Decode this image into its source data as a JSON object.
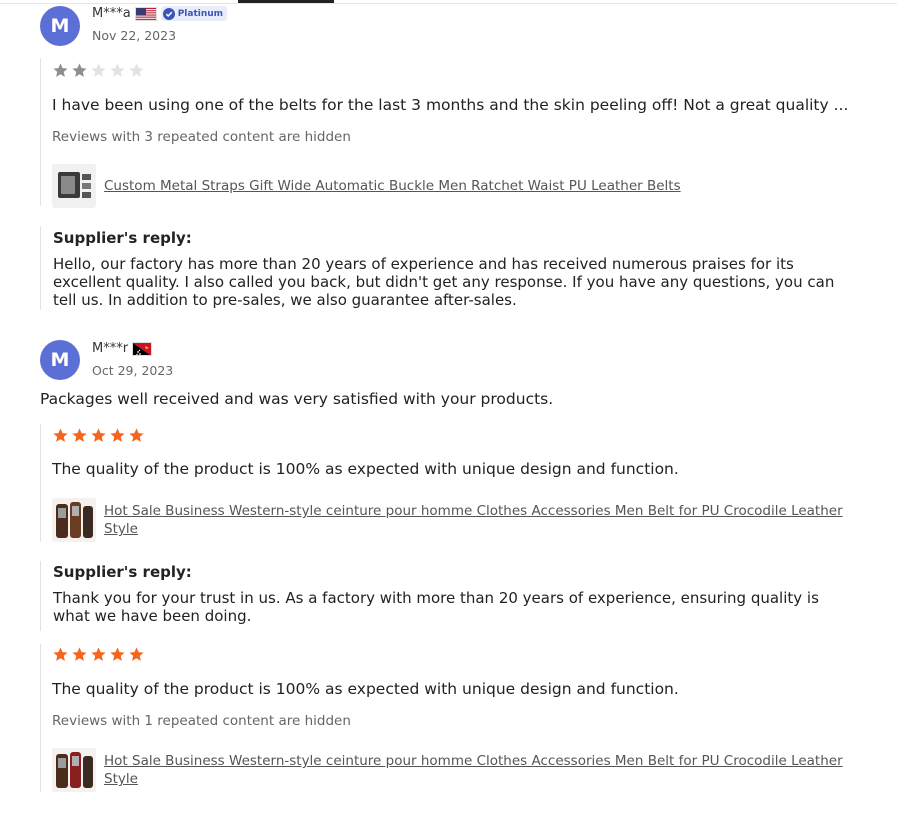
{
  "colors": {
    "avatar": "#5b6fd6",
    "star_filled_orange": "#f5651d",
    "star_filled_gray": "#8e8e8e",
    "star_empty": "#e3e3e3",
    "badge_bg": "#e8edf9",
    "badge_text": "#3b56b8"
  },
  "reviews": [
    {
      "avatar_letter": "M",
      "user": "M***a",
      "flag": "us-flag-icon",
      "badge": "Platinum",
      "date": "Nov 22, 2023",
      "rating": 2,
      "text": "I have been using one of the belts for the last 3 months and the skin peeling off! Not a great quality ...",
      "hidden_note": "Reviews with 3 repeated content are hidden",
      "product": "Custom Metal Straps Gift Wide Automatic Buckle Men Ratchet Waist PU Leather Belts",
      "reply_title": "Supplier's reply:",
      "reply_text": "Hello, our factory has more than 20 years of experience and has received numerous praises for its excellent quality. I also called you back, but didn't get any response. If you have any questions, you can tell us. In addition to pre-sales, we also guarantee after-sales."
    },
    {
      "avatar_letter": "M",
      "user": "M***r",
      "flag": "papua-new-guinea-flag-icon",
      "date": "Oct 29, 2023",
      "headline": "Packages well received and was very satisfied with your products.",
      "entries": [
        {
          "rating": 5,
          "text": "The quality of the product is 100% as expected with unique design and function.",
          "product": "Hot Sale Business Western-style ceinture pour homme Clothes Accessories Men Belt for PU Crocodile Leather Style",
          "reply_title": "Supplier's reply:",
          "reply_text": "Thank you for your trust in us. As a factory with more than 20 years of experience, ensuring quality is what we have been doing."
        },
        {
          "rating": 5,
          "text": "The quality of the product is 100% as expected with unique design and function.",
          "hidden_note": "Reviews with 1 repeated content are hidden",
          "product": "Hot Sale Business Western-style ceinture pour homme Clothes Accessories Men Belt for PU Crocodile Leather Style"
        }
      ]
    }
  ]
}
